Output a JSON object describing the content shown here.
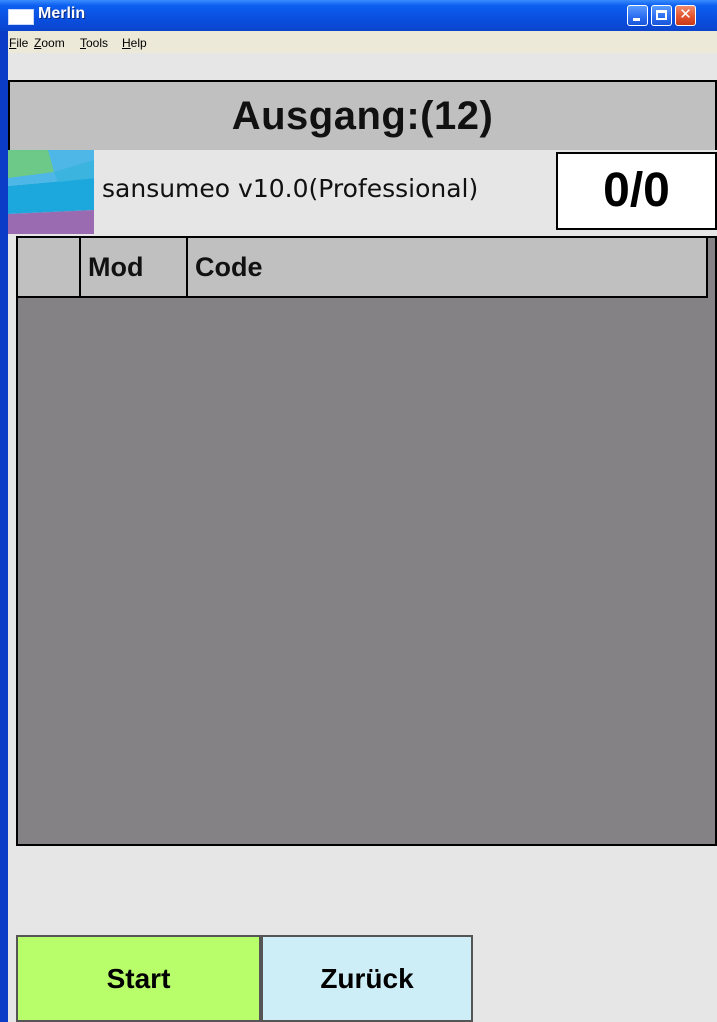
{
  "window": {
    "title": "Merlin"
  },
  "menu": {
    "items": [
      {
        "accel": "F",
        "rest": "ile"
      },
      {
        "accel": "Z",
        "rest": "oom"
      },
      {
        "accel": "T",
        "rest": "ools"
      },
      {
        "accel": "H",
        "rest": "elp"
      }
    ]
  },
  "header": {
    "title": "Ausgang:(12)"
  },
  "app": {
    "name": "sansumeo v10.0(Professional)",
    "counter": "0/0"
  },
  "table": {
    "columns": [
      "",
      "Mod",
      "Code"
    ],
    "rows": []
  },
  "buttons": {
    "start": "Start",
    "back": "Zurück"
  },
  "colors": {
    "start_button": "#b8fd6a",
    "back_button": "#cdeef6",
    "table_body": "#848284",
    "header_bar": "#c0c0c0"
  }
}
